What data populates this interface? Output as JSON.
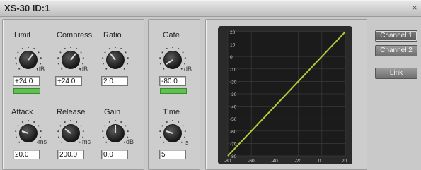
{
  "window": {
    "title": "XS-30 ID:1",
    "close_glyph": "×"
  },
  "compressor": {
    "limit": {
      "label": "Limit",
      "value": "+24.0",
      "unit": "dB"
    },
    "compress": {
      "label": "Compress",
      "value": "+24.0",
      "unit": "dB"
    },
    "ratio": {
      "label": "Ratio",
      "value": "2.0"
    },
    "attack": {
      "label": "Attack",
      "value": "20.0",
      "unit": "ms"
    },
    "release": {
      "label": "Release",
      "value": "200.0",
      "unit": "ms"
    },
    "gain": {
      "label": "Gain",
      "value": "0.0",
      "unit": "dB"
    }
  },
  "gate": {
    "gate": {
      "label": "Gate",
      "value": "-80.0",
      "unit": "dB"
    },
    "time": {
      "label": "Time",
      "value": "5",
      "unit": "s"
    }
  },
  "buttons": {
    "channel1": "Channel 1",
    "channel2": "Channel 2",
    "link": "Link"
  },
  "colors": {
    "window_bg": "#c9c9c9",
    "meter_green": "#5fc14f",
    "graph_bg": "#1b1b1b",
    "curve": "#b6cc3a"
  },
  "graph": {
    "y_ticks": [
      "20",
      "10",
      "0",
      "-10",
      "-20",
      "-30",
      "-40",
      "-50",
      "-60",
      "-70",
      "-80"
    ],
    "x_ticks": [
      "-80",
      "-60",
      "-40",
      "-20",
      "0",
      "20"
    ]
  }
}
